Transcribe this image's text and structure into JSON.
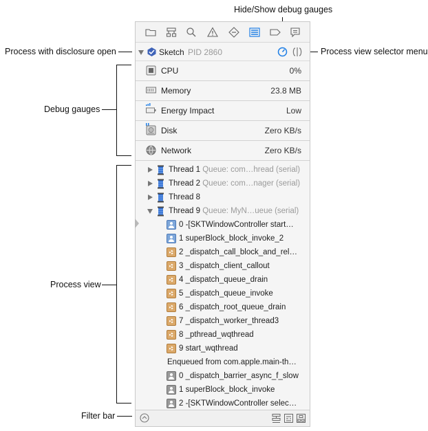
{
  "callouts": {
    "hide_show_debug_gauges": "Hide/Show debug gauges",
    "process_disclosure": "Process with disclosure open",
    "process_view_selector": "Process view selector menu",
    "debug_gauges": "Debug gauges",
    "process_view": "Process view",
    "filter_bar": "Filter bar"
  },
  "toolbar": {
    "icons": [
      "folder-icon",
      "hierarchy-icon",
      "search-icon",
      "warning-icon",
      "test-icon",
      "debug-navigator-icon",
      "breakpoint-icon",
      "log-icon"
    ],
    "selected": "debug-navigator-icon"
  },
  "process": {
    "name": "Sketch",
    "pid": "PID 2860"
  },
  "gauges": [
    {
      "name": "CPU",
      "value": "0%",
      "icon": "cpu-icon"
    },
    {
      "name": "Memory",
      "value": "23.8 MB",
      "icon": "memory-icon"
    },
    {
      "name": "Energy Impact",
      "value": "Low",
      "icon": "energy-icon"
    },
    {
      "name": "Disk",
      "value": "Zero KB/s",
      "icon": "disk-icon"
    },
    {
      "name": "Network",
      "value": "Zero KB/s",
      "icon": "network-icon"
    }
  ],
  "threads": [
    {
      "name": "Thread 1",
      "queue": "Queue: com…hread (serial)"
    },
    {
      "name": "Thread 2",
      "queue": "Queue: com…nager (serial)"
    },
    {
      "name": "Thread 8",
      "queue": ""
    },
    {
      "name": "Thread 9",
      "queue": "Queue: MyN…ueue (serial)"
    }
  ],
  "frames": [
    {
      "label": "0 -[SKTWindowController start…",
      "kind": "user"
    },
    {
      "label": "1 superBlock_block_invoke_2",
      "kind": "user"
    },
    {
      "label": "2 _dispatch_call_block_and_rel…",
      "kind": "sys"
    },
    {
      "label": "3 _dispatch_client_callout",
      "kind": "sys"
    },
    {
      "label": "4 _dispatch_queue_drain",
      "kind": "sys"
    },
    {
      "label": "5 _dispatch_queue_invoke",
      "kind": "sys"
    },
    {
      "label": "6 _dispatch_root_queue_drain",
      "kind": "sys"
    },
    {
      "label": "7 _dispatch_worker_thread3",
      "kind": "sys"
    },
    {
      "label": "8 _pthread_wqthread",
      "kind": "sys"
    },
    {
      "label": "9 start_wqthread",
      "kind": "sys"
    }
  ],
  "enqueued": "Enqueued from com.apple.main-th…",
  "enqueued_frames": [
    {
      "label": "0 _dispatch_barrier_async_f_slow",
      "kind": "gray"
    },
    {
      "label": "1 superBlock_block_invoke",
      "kind": "gray"
    },
    {
      "label": "2 -[SKTWindowController selec…",
      "kind": "gray"
    }
  ],
  "colors": {
    "accent": "#1f7fe6",
    "frame_user": "#7ea7da",
    "frame_system": "#dba96a"
  }
}
